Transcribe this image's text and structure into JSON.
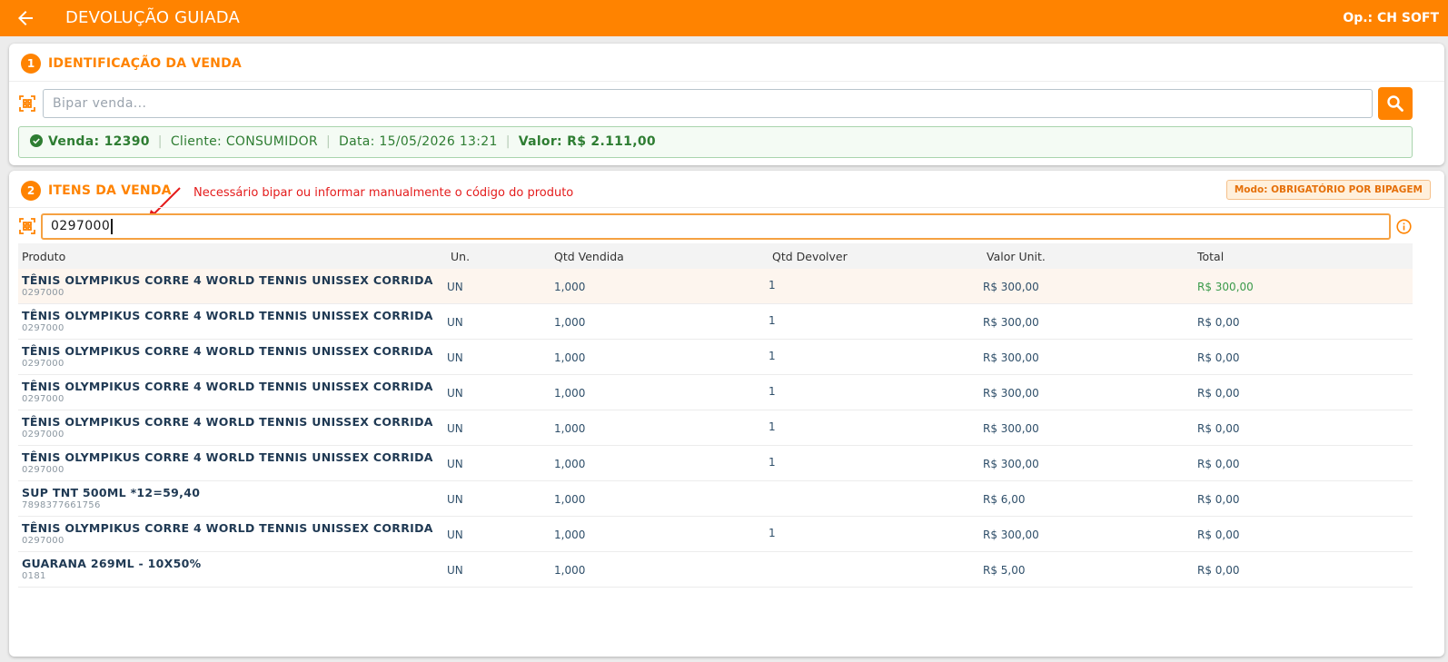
{
  "header": {
    "title": "DEVOLUÇÃO GUIADA",
    "operator": "Op.: CH SOFT"
  },
  "section1": {
    "step": "1",
    "title": "IDENTIFICAÇÃO DA VENDA",
    "search_placeholder": "Bipar venda...",
    "sale_info": {
      "venda": "Venda: 12390",
      "cliente": "Cliente: CONSUMIDOR",
      "data": "Data: 15/05/2026 13:21",
      "valor": "Valor: R$ 2.111,00"
    }
  },
  "section2": {
    "step": "2",
    "title": "ITENS DA VENDA",
    "annotation": "Necessário bipar ou informar manualmente o código do produto",
    "mode_badge": "Modo: OBRIGATÓRIO POR BIPAGEM",
    "scan_value": "0297000",
    "columns": {
      "produto": "Produto",
      "un": "Un.",
      "qtd_vendida": "Qtd Vendida",
      "qtd_devolver": "Qtd Devolver",
      "valor_unit": "Valor Unit.",
      "total": "Total"
    },
    "rows": [
      {
        "name": "TÊNIS OLYMPIKUS CORRE 4 WORLD TENNIS UNISSEX CORRIDA",
        "code": "0297000",
        "un": "UN",
        "qtd_vendida": "1,000",
        "qtd_devolver": "1",
        "valor_unit": "R$ 300,00",
        "total": "R$ 300,00"
      },
      {
        "name": "TÊNIS OLYMPIKUS CORRE 4 WORLD TENNIS UNISSEX CORRIDA",
        "code": "0297000",
        "un": "UN",
        "qtd_vendida": "1,000",
        "qtd_devolver": "1",
        "valor_unit": "R$ 300,00",
        "total": "R$ 0,00"
      },
      {
        "name": "TÊNIS OLYMPIKUS CORRE 4 WORLD TENNIS UNISSEX CORRIDA",
        "code": "0297000",
        "un": "UN",
        "qtd_vendida": "1,000",
        "qtd_devolver": "1",
        "valor_unit": "R$ 300,00",
        "total": "R$ 0,00"
      },
      {
        "name": "TÊNIS OLYMPIKUS CORRE 4 WORLD TENNIS UNISSEX CORRIDA",
        "code": "0297000",
        "un": "UN",
        "qtd_vendida": "1,000",
        "qtd_devolver": "1",
        "valor_unit": "R$ 300,00",
        "total": "R$ 0,00"
      },
      {
        "name": "TÊNIS OLYMPIKUS CORRE 4 WORLD TENNIS UNISSEX CORRIDA",
        "code": "0297000",
        "un": "UN",
        "qtd_vendida": "1,000",
        "qtd_devolver": "1",
        "valor_unit": "R$ 300,00",
        "total": "R$ 0,00"
      },
      {
        "name": "TÊNIS OLYMPIKUS CORRE 4 WORLD TENNIS UNISSEX CORRIDA",
        "code": "0297000",
        "un": "UN",
        "qtd_vendida": "1,000",
        "qtd_devolver": "1",
        "valor_unit": "R$ 300,00",
        "total": "R$ 0,00"
      },
      {
        "name": "SUP TNT 500ML *12=59,40",
        "code": "7898377661756",
        "un": "UN",
        "qtd_vendida": "1,000",
        "qtd_devolver": "",
        "valor_unit": "R$ 6,00",
        "total": "R$ 0,00"
      },
      {
        "name": "TÊNIS OLYMPIKUS CORRE 4 WORLD TENNIS UNISSEX CORRIDA",
        "code": "0297000",
        "un": "UN",
        "qtd_vendida": "1,000",
        "qtd_devolver": "1",
        "valor_unit": "R$ 300,00",
        "total": "R$ 0,00"
      },
      {
        "name": "GUARANA 269ML - 10X50%",
        "code": "0181",
        "un": "UN",
        "qtd_vendida": "1,000",
        "qtd_devolver": "",
        "valor_unit": "R$ 5,00",
        "total": "R$ 0,00"
      }
    ]
  },
  "colors": {
    "accent": "#ff8300",
    "success": "#2e7d32",
    "annotation": "#e41c1c"
  },
  "icons": {
    "back": "arrow-left-icon",
    "scan": "qr-scan-icon",
    "search": "search-icon",
    "check": "check-circle-icon",
    "info": "info-icon"
  }
}
